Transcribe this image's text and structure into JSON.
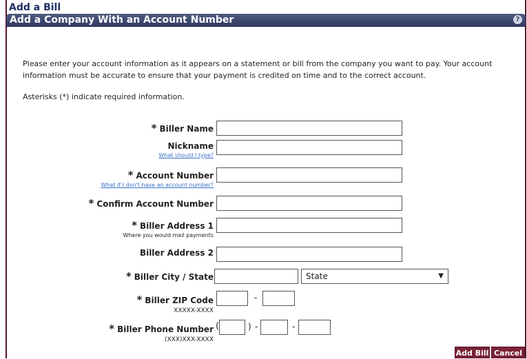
{
  "page": {
    "title": "Add a Bill"
  },
  "section": {
    "title": "Add a Company With an Account Number",
    "help_icon": "?"
  },
  "intro_text": "Please enter your account information as it appears on a statement or bill from the company you want to pay. Your account information must be accurate to ensure that your payment is credited on time and to the correct account.",
  "required_note": "Asterisks (*) indicate required information.",
  "fields": {
    "biller_name": {
      "star": "*",
      "label": "Biller Name",
      "value": ""
    },
    "nickname": {
      "label": "Nickname",
      "help_link": "What should I type?",
      "value": ""
    },
    "account_number": {
      "star": "*",
      "label": "Account Number",
      "help_link": "What if I don't have an account number?",
      "value": ""
    },
    "confirm_account": {
      "star": "*",
      "label": "Confirm Account Number",
      "value": ""
    },
    "address1": {
      "star": "*",
      "label": "Biller Address 1",
      "hint": "Where you would mail payments",
      "value": ""
    },
    "address2": {
      "label": "Biller Address 2",
      "value": ""
    },
    "city_state": {
      "star": "*",
      "label": "Biller City / State",
      "city_value": "",
      "state_selected": "State"
    },
    "zip": {
      "star": "*",
      "label": "Biller ZIP Code",
      "hint": "XXXXX-XXXX",
      "separator": "-"
    },
    "phone": {
      "star": "*",
      "label": "Biller Phone Number",
      "hint": "(XXX)XXX-XXXX",
      "open_paren": "(",
      "close_paren": ")",
      "dash1": "-",
      "dash2": "-"
    }
  },
  "buttons": {
    "add_bill": "Add Bill",
    "cancel": "Cancel"
  },
  "colors": {
    "brand_maroon": "#7a2236",
    "header_navy": "#2d3860",
    "title_blue": "#1f2f63",
    "link_blue": "#3a6fc4"
  }
}
